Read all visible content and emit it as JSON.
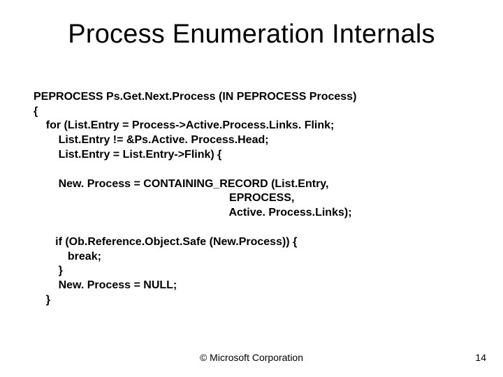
{
  "title": "Process Enumeration Internals",
  "code": {
    "l1": "PEPROCESS Ps.Get.Next.Process (IN PEPROCESS Process)",
    "l2": "{",
    "l3": "    for (List.Entry = Process->Active.Process.Links. Flink;",
    "l4": "        List.Entry != &Ps.Active. Process.Head;",
    "l5": "        List.Entry = List.Entry->Flink) {",
    "l6": "",
    "l7": "        New. Process = CONTAINING_RECORD (List.Entry,",
    "l8": "                                                               EPROCESS,",
    "l9": "                                                               Active. Process.Links);",
    "l10": "",
    "l11": "       if (Ob.Reference.Object.Safe (New.Process)) {",
    "l12": "           break;",
    "l13": "        }",
    "l14": "        New. Process = NULL;",
    "l15": "    }"
  },
  "footer": "© Microsoft Corporation",
  "page_number": "14"
}
